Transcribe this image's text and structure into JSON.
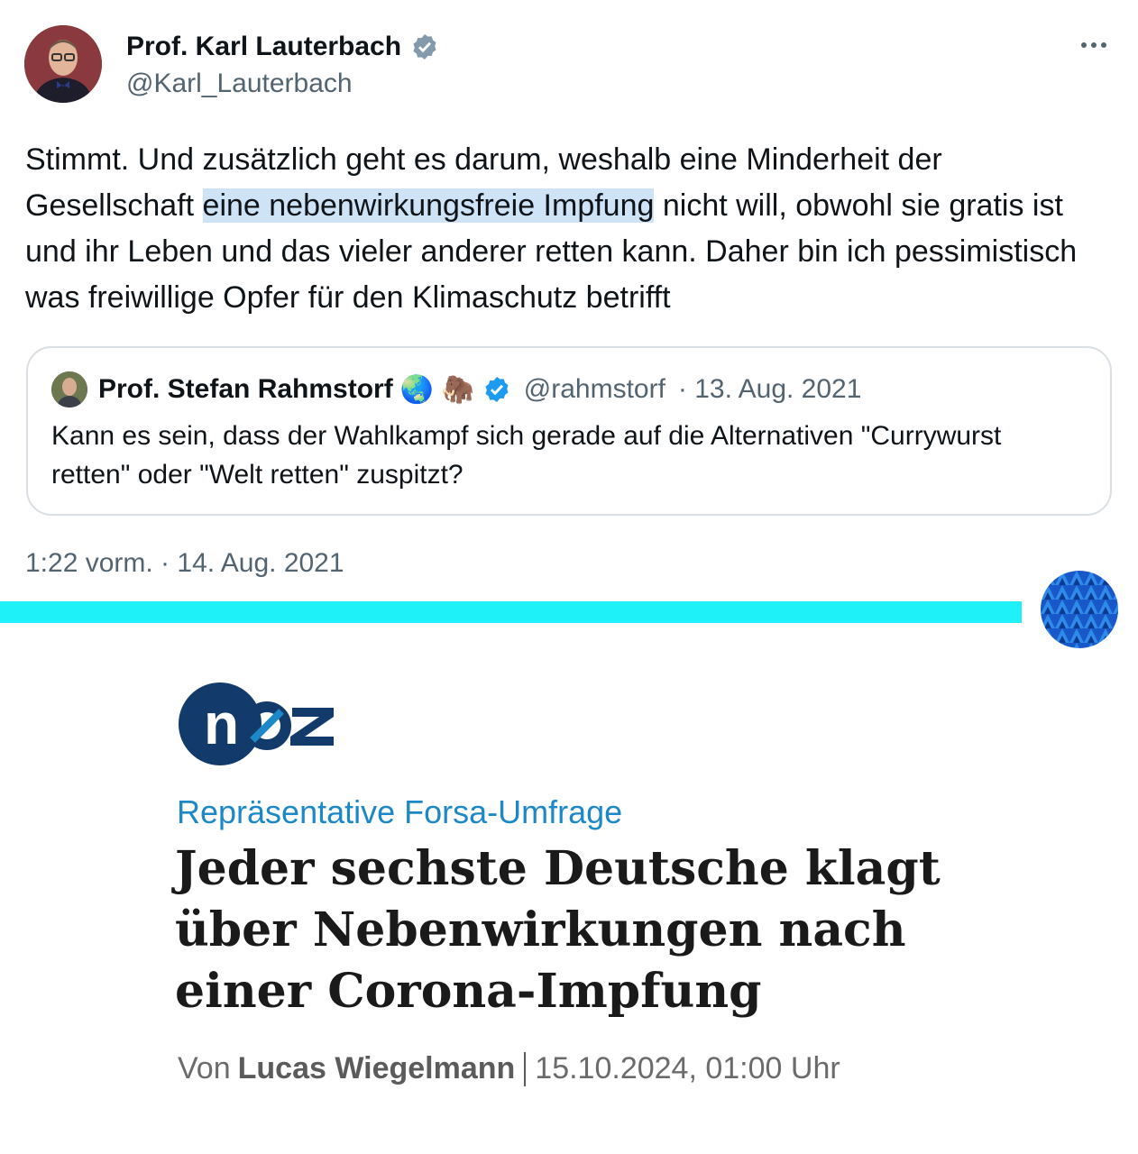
{
  "tweet": {
    "author_name": "Prof. Karl Lauterbach",
    "author_handle": "@Karl_Lauterbach",
    "text_before": "Stimmt. Und zusätzlich geht es darum, weshalb eine Minderheit der Gesellschaft ",
    "text_highlight": "eine nebenwirkungsfreie Impfung",
    "text_after": " nicht will, obwohl sie gratis ist und ihr Leben und das vieler anderer retten kann. Daher bin ich pessimistisch was freiwillige Opfer für den Klimaschutz betrifft",
    "timestamp": "1:22 vorm. · 14. Aug. 2021",
    "verified_icon": "verified-badge-icon",
    "more_icon": "more-options-icon"
  },
  "quoted_tweet": {
    "author_name": "Prof. Stefan Rahmstorf",
    "emojis": "🌏 🦣",
    "author_handle": "@rahmstorf",
    "date": "· 13. Aug. 2021",
    "text": "Kann es sein, dass der Wahlkampf sich gerade auf die Alternativen \"Currywurst retten\" oder \"Welt retten\" zuspitzt?"
  },
  "article": {
    "logo_text": "noz",
    "kicker": "Repräsentative Forsa-Umfrage",
    "headline": "Jeder sechste Deutsche klagt über Nebenwirkungen nach einer Corona-Impfung",
    "byline_prefix": "Von",
    "byline_author": "Lucas Wiegelmann",
    "byline_date": "15.10.2024, 01:00 Uhr"
  },
  "colors": {
    "divider_cyan": "#1ff1f8",
    "kicker_blue": "#1c88c8",
    "verified_blue": "#1d9bf0",
    "logo_navy": "#123a6b"
  }
}
